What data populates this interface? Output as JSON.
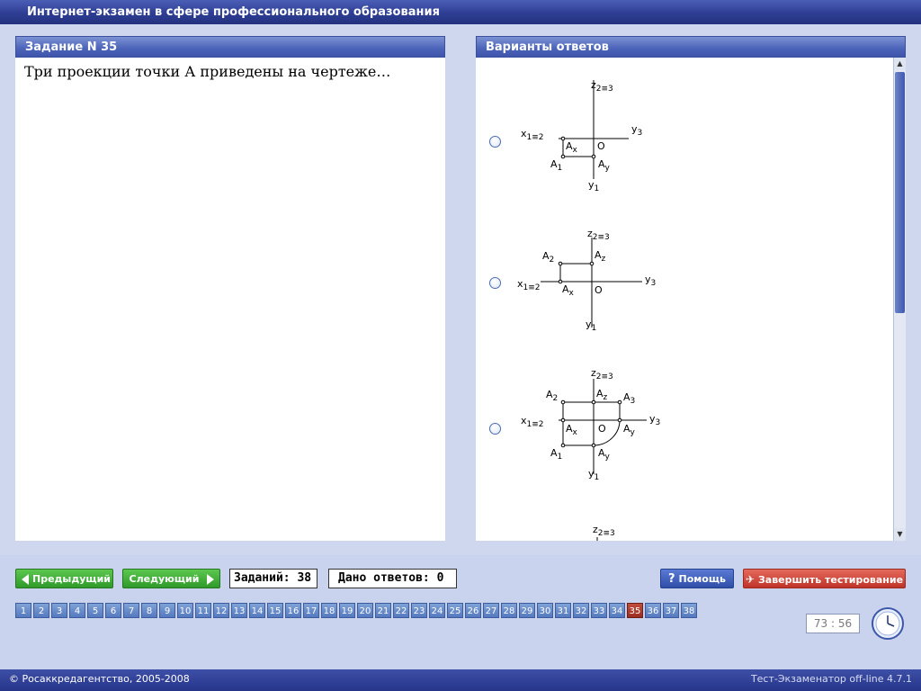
{
  "window": {
    "title": "Интернет-экзамен в сфере профессионального образования"
  },
  "question_panel": {
    "header": "Задание N 35",
    "text": "Три проекции точки А приведены на чертеже…"
  },
  "answers_panel": {
    "header": "Варианты ответов",
    "options": [
      {
        "labels": {
          "z": "z",
          "z_sub": "2≡3",
          "x": "x",
          "x_sub": "1≡2",
          "y": "y",
          "y_sub": "3",
          "y1": "y",
          "y1_sub": "1",
          "O": "O",
          "Ax": "A",
          "Ax_sub": "x",
          "A1": "A",
          "A1_sub": "1",
          "Ay": "A",
          "Ay_sub": "y"
        }
      },
      {
        "labels": {
          "z": "z",
          "z_sub": "2≡3",
          "x": "x",
          "x_sub": "1≡2",
          "y": "y",
          "y_sub": "3",
          "y1": "y",
          "y1_sub": "1",
          "O": "O",
          "A2": "A",
          "A2_sub": "2",
          "Az": "A",
          "Az_sub": "z",
          "Ax": "A",
          "Ax_sub": "x"
        }
      },
      {
        "labels": {
          "z": "z",
          "z_sub": "2≡3",
          "x": "x",
          "x_sub": "1≡2",
          "y": "y",
          "y_sub": "3",
          "y1": "y",
          "y1_sub": "1",
          "O": "O",
          "A2": "A",
          "A2_sub": "2",
          "Az": "A",
          "Az_sub": "z",
          "A3": "A",
          "A3_sub": "3",
          "Ax": "A",
          "Ax_sub": "x",
          "Ay": "A",
          "Ay_sub": "y",
          "A1": "A",
          "A1_sub": "1",
          "Ay2": "A",
          "Ay2_sub": "y"
        }
      },
      {
        "labels": {
          "z": "z",
          "z_sub": "2≡3"
        }
      }
    ]
  },
  "controls": {
    "prev_label": "Предыдущий",
    "next_label": "Следующий",
    "tasks_count": "Заданий: 38",
    "answers_given": "Дано ответов: 0",
    "help_label": "Помощь",
    "finish_label": "Завершить тестирование"
  },
  "navigation": {
    "numbers": [
      "1",
      "2",
      "3",
      "4",
      "5",
      "6",
      "7",
      "8",
      "9",
      "10",
      "11",
      "12",
      "13",
      "14",
      "15",
      "16",
      "17",
      "18",
      "19",
      "20",
      "21",
      "22",
      "23",
      "24",
      "25",
      "26",
      "27",
      "28",
      "29",
      "30",
      "31",
      "32",
      "33",
      "34",
      "35",
      "36",
      "37",
      "38"
    ],
    "current": "35"
  },
  "timer": {
    "value": "73 : 56"
  },
  "footer": {
    "copyright": "© Росаккредагентство, 2005-2008",
    "version": "Тест-Экзаменатор off-line 4.7.1"
  },
  "colors": {
    "titlebar": "#2d3d93",
    "panel_header": "#4b63b8",
    "button_green": "#2f9a2a",
    "button_blue": "#2e4ea8",
    "button_red": "#bf3328",
    "nav_current": "#9b2d21"
  },
  "icons": {
    "prev": "arrow-left-icon",
    "next": "arrow-right-icon",
    "help": "question-icon",
    "finish": "running-man-icon",
    "clock": "clock-icon"
  }
}
